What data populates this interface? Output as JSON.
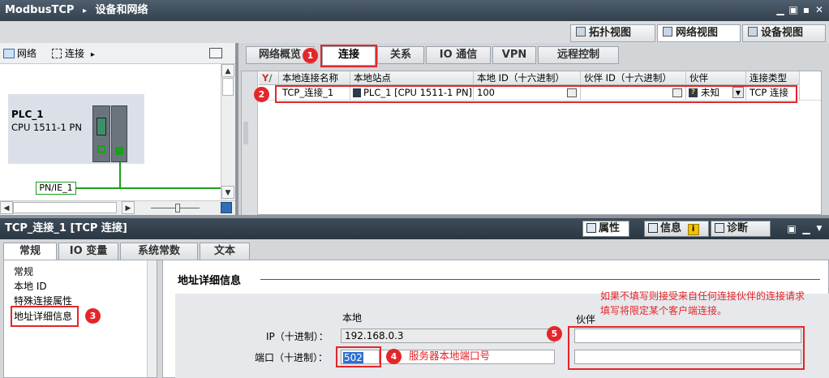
{
  "title": {
    "app": "ModbusTCP",
    "sep": "▸",
    "section": "设备和网络",
    "min": "▁",
    "restore": "▣",
    "max": "▪",
    "close": "✕"
  },
  "views": {
    "topology": "拓扑视图",
    "network": "网络视图",
    "device": "设备视图"
  },
  "left_toolbar": {
    "network": "网络",
    "connect": "连接",
    "arrow": "▸"
  },
  "network": {
    "plc_name": "PLC_1",
    "plc_type": "CPU 1511-1 PN",
    "subnet": "PN/IE_1"
  },
  "tabs": [
    "网络概览",
    "连接",
    "关系",
    "IO 通信",
    "VPN",
    "远程控制"
  ],
  "grid": {
    "headers": [
      "本地连接名称",
      "本地站点",
      "本地 ID（十六进制）",
      "伙伴 ID（十六进制）",
      "伙伴",
      "连接类型"
    ],
    "row": {
      "name": "TCP_连接_1",
      "station": "PLC_1 [CPU 1511-1 PN]",
      "local_id": "100",
      "partner_id": "",
      "partner": "未知",
      "type": "TCP 连接"
    }
  },
  "badges": [
    "1",
    "2",
    "3",
    "4",
    "5"
  ],
  "props": {
    "title": "TCP_连接_1 [TCP 连接]",
    "btn_props": "属性",
    "btn_info": "信息",
    "btn_diag": "诊断",
    "info_mark": "i",
    "tabs": [
      "常规",
      "IO 变量",
      "系统常数",
      "文本"
    ],
    "nav": [
      "常规",
      "本地 ID",
      "特殊连接属性",
      "地址详细信息"
    ]
  },
  "address": {
    "heading": "地址详细信息",
    "col_local": "本地",
    "col_partner": "伙伴",
    "ip_label": "IP（十进制）：",
    "ip_value": "192.168.0.3",
    "port_label": "端口（十进制）：",
    "port_value": "502",
    "port_note": "服务器本地端口号",
    "partner_note_1": "如果不填写则接受来自任何连接伙伴的连接请求",
    "partner_note_2": "填写将限定某个客户端连接。"
  },
  "colors": {
    "accent": "#e3262a",
    "plc_green": "#1aa01a"
  }
}
